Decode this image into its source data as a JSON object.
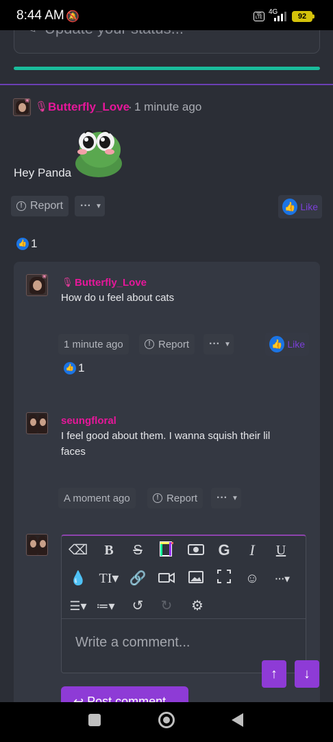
{
  "statusbar": {
    "time": "8:44 AM",
    "network": "4G",
    "volte": "Vo LTE",
    "battery": "92"
  },
  "status_update": {
    "placeholder": "Update your status..."
  },
  "post": {
    "author": "Butterfly_Love",
    "separator": "·",
    "time": "1 minute ago",
    "text": "Hey Panda",
    "report_label": "Report",
    "more_label": "···",
    "like_label": "Like",
    "like_count": "1"
  },
  "comments": [
    {
      "author": "Butterfly_Love",
      "text": "How do u feel about cats",
      "time": "1 minute ago",
      "report_label": "Report",
      "more_label": "···",
      "like_label": "Like",
      "like_count": "1"
    },
    {
      "author": "seungfloral",
      "text_line1": "I feel good about them. I wanna squish their lil",
      "text_line2": "faces",
      "time": "A moment ago",
      "report_label": "Report",
      "more_label": "···"
    }
  ],
  "editor": {
    "placeholder": "Write a comment...",
    "post_label": "Post comment",
    "toolbar": [
      "eraser-icon",
      "bold-icon",
      "strikethrough-icon",
      "giphy-icon",
      "money-icon",
      "google-icon",
      "italic-icon",
      "underline-icon",
      "color-drop-icon",
      "text-size-icon",
      "link-icon",
      "video-icon",
      "image-icon",
      "fullscreen-icon",
      "emoji-icon",
      "more-icon",
      "align-icon",
      "list-icon",
      "undo-icon",
      "redo-icon",
      "settings-icon"
    ]
  },
  "colors": {
    "accent_purple": "#8e3bd6",
    "username_pink": "#e6179a",
    "progress_green": "#1abc9c",
    "like_blue": "#1b74e4"
  }
}
